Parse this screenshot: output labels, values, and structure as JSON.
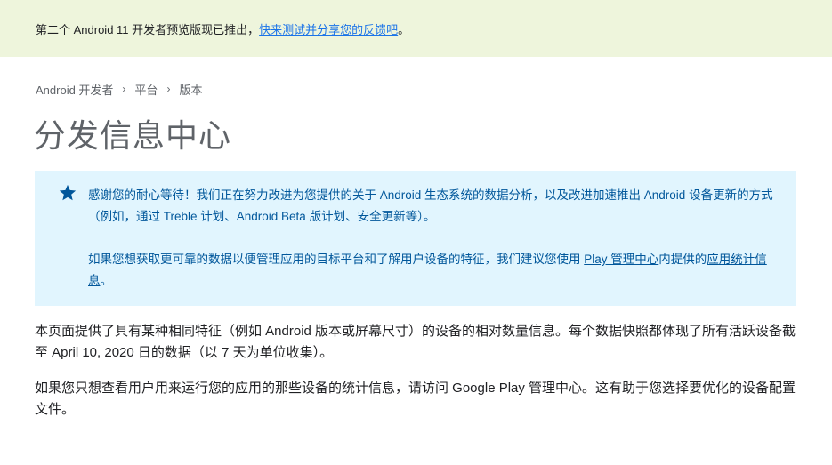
{
  "banner": {
    "text": "第二个 Android 11 开发者预览版现已推出，",
    "link": "快来测试并分享您的反馈吧",
    "suffix": "。"
  },
  "breadcrumb": {
    "items": [
      "Android 开发者",
      "平台",
      "版本"
    ],
    "separator": "›"
  },
  "page_title": "分发信息中心",
  "notice": {
    "icon": "star-icon",
    "color": "#01579b",
    "background": "#e1f5fe",
    "para1": "感谢您的耐心等待！我们正在努力改进为您提供的关于 Android 生态系统的数据分析，以及改进加速推出 Android 设备更新的方式（例如，通过 Treble 计划、Android Beta 版计划、安全更新等）。",
    "para2_prefix": "如果您想获取更可靠的数据以便管理应用的目标平台和了解用户设备的特征，我们建议您使用 ",
    "para2_link1": "Play 管理中心",
    "para2_middle": "内提供的",
    "para2_link2": "应用统计信息",
    "para2_suffix": "。"
  },
  "content": {
    "para1": "本页面提供了具有某种相同特征（例如 Android 版本或屏幕尺寸）的设备的相对数量信息。每个数据快照都体现了所有活跃设备截至 April 10, 2020 日的数据（以 7 天为单位收集）。",
    "para2": "如果您只想查看用户用来运行您的应用的那些设备的统计信息，请访问 Google Play 管理中心。这有助于您选择要优化的设备配置文件。"
  },
  "colors": {
    "banner_bg": "#eef5dc",
    "link": "#1a73e8",
    "title": "#5f6368"
  }
}
